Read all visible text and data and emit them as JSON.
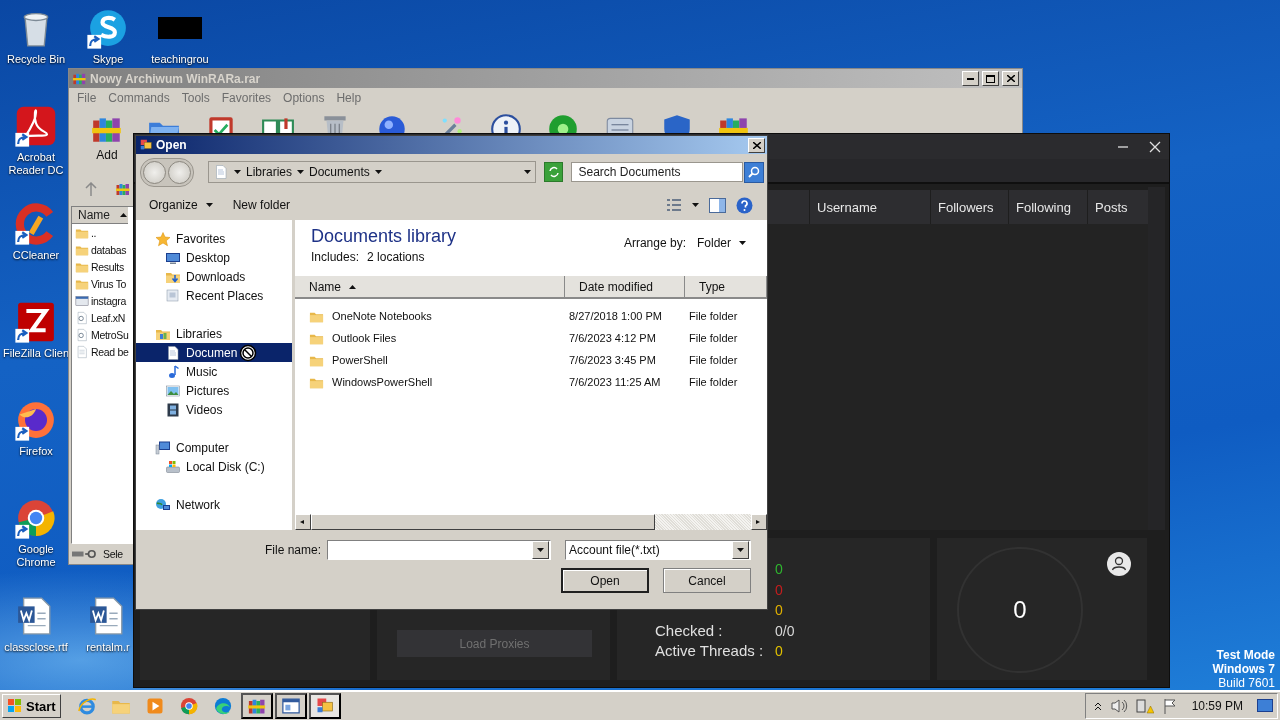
{
  "desktop_icons": [
    {
      "label": "Recycle Bin",
      "kind": "recycle",
      "shortcut": false
    },
    {
      "label": "Skype",
      "kind": "skype",
      "shortcut": true
    },
    {
      "label": "teachingrou",
      "kind": "redacted",
      "shortcut": false
    },
    {
      "label": "Acrobat Reader DC",
      "kind": "acrobat",
      "shortcut": true
    },
    {
      "label": "CCleaner",
      "kind": "ccleaner",
      "shortcut": true
    },
    {
      "label": "FileZilla Clien",
      "kind": "filezilla",
      "shortcut": true
    },
    {
      "label": "Firefox",
      "kind": "firefox",
      "shortcut": true
    },
    {
      "label": "Google Chrome",
      "kind": "chrome",
      "shortcut": true
    },
    {
      "label": "classclose.rtf",
      "kind": "word",
      "shortcut": false
    },
    {
      "label": "rentalm.r",
      "kind": "word",
      "shortcut": false
    }
  ],
  "winrar": {
    "title": "Nowy Archiwum WinRARa.rar",
    "menu": [
      "File",
      "Commands",
      "Tools",
      "Favorites",
      "Options",
      "Help"
    ],
    "toolbar": [
      {
        "kind": "add",
        "label": "Add"
      },
      {
        "kind": "extract"
      },
      {
        "kind": "test"
      },
      {
        "kind": "view"
      },
      {
        "kind": "delete"
      },
      {
        "kind": "find"
      },
      {
        "kind": "wizard"
      },
      {
        "kind": "info"
      },
      {
        "kind": "virus"
      },
      {
        "kind": "comment"
      },
      {
        "kind": "protect"
      },
      {
        "kind": "sfx"
      }
    ],
    "list_header": "Name",
    "files": [
      {
        "name": "..",
        "kind": "folder"
      },
      {
        "name": "databas",
        "kind": "folder"
      },
      {
        "name": "Results",
        "kind": "folder"
      },
      {
        "name": "Virus To",
        "kind": "folder"
      },
      {
        "name": "instagra",
        "kind": "exe"
      },
      {
        "name": "Leaf.xN",
        "kind": "script"
      },
      {
        "name": "MetroSu",
        "kind": "script"
      },
      {
        "name": "Read be",
        "kind": "text"
      }
    ],
    "status": "Sele"
  },
  "app": {
    "columns": [
      "Username",
      "Followers",
      "Following",
      "Posts"
    ],
    "load_button": {
      "label": "Load Proxies",
      "disabled": true
    },
    "stats": [
      {
        "value": "0",
        "color": "#2fb52f"
      },
      {
        "value": "0",
        "color": "#c41e1e"
      },
      {
        "value": "0",
        "color": "#e0b000"
      },
      {
        "label": "Checked :",
        "value": "0/0",
        "color": "#d8d8d8"
      },
      {
        "label": "Active Threads :",
        "value": "0",
        "color": "#e0c000"
      }
    ],
    "counter": "0"
  },
  "dialog": {
    "title": "Open",
    "breadcrumb": [
      "Libraries",
      "Documents"
    ],
    "search_placeholder": "Search Documents",
    "organize": "Organize",
    "new_folder": "New folder",
    "nav": [
      {
        "label": "Favorites",
        "kind": "star",
        "selected": false,
        "children": [
          {
            "label": "Desktop",
            "kind": "desktop",
            "selected": false
          },
          {
            "label": "Downloads",
            "kind": "downloads",
            "selected": false
          },
          {
            "label": "Recent Places",
            "kind": "recent",
            "selected": false
          }
        ]
      },
      {
        "label": "Libraries",
        "kind": "library",
        "selected": false,
        "children": [
          {
            "label": "Documen",
            "kind": "documents",
            "selected": true
          },
          {
            "label": "Music",
            "kind": "music",
            "selected": false
          },
          {
            "label": "Pictures",
            "kind": "pictures",
            "selected": false
          },
          {
            "label": "Videos",
            "kind": "videos",
            "selected": false
          }
        ]
      },
      {
        "label": "Computer",
        "kind": "computer",
        "selected": false,
        "children": [
          {
            "label": "Local Disk (C:)",
            "kind": "disk",
            "selected": false
          }
        ]
      },
      {
        "label": "Network",
        "kind": "network",
        "selected": false
      }
    ],
    "library_title": "Documents library",
    "includes_label": "Includes:",
    "includes_link": "2 locations",
    "arrange_label": "Arrange by:",
    "arrange_value": "Folder",
    "columns": [
      "Name",
      "Date modified",
      "Type"
    ],
    "rows": [
      {
        "name": "OneNote Notebooks",
        "date": "8/27/2018 1:00 PM",
        "type": "File folder"
      },
      {
        "name": "Outlook Files",
        "date": "7/6/2023 4:12 PM",
        "type": "File folder"
      },
      {
        "name": "PowerShell",
        "date": "7/6/2023 3:45 PM",
        "type": "File folder"
      },
      {
        "name": "WindowsPowerShell",
        "date": "7/6/2023 11:25 AM",
        "type": "File folder"
      }
    ],
    "file_name_label": "File name:",
    "filter": "Account file(*.txt)",
    "buttons": [
      "Open",
      "Cancel"
    ]
  },
  "desktop_notice": [
    "Test Mode",
    "Windows 7",
    "Build 7601"
  ],
  "taskbar": {
    "start": "Start",
    "apps": [
      {
        "kind": "ie",
        "open": false,
        "selected": false
      },
      {
        "kind": "explorer",
        "open": false,
        "selected": false
      },
      {
        "kind": "media",
        "open": false,
        "selected": false
      },
      {
        "kind": "chrome",
        "open": false,
        "selected": false
      },
      {
        "kind": "edge",
        "open": false,
        "selected": false
      },
      {
        "kind": "winrar",
        "open": true,
        "selected": false
      },
      {
        "kind": "window",
        "open": true,
        "selected": false
      },
      {
        "kind": "dialog",
        "open": true,
        "selected": true
      }
    ],
    "clock": "10:59 PM"
  }
}
